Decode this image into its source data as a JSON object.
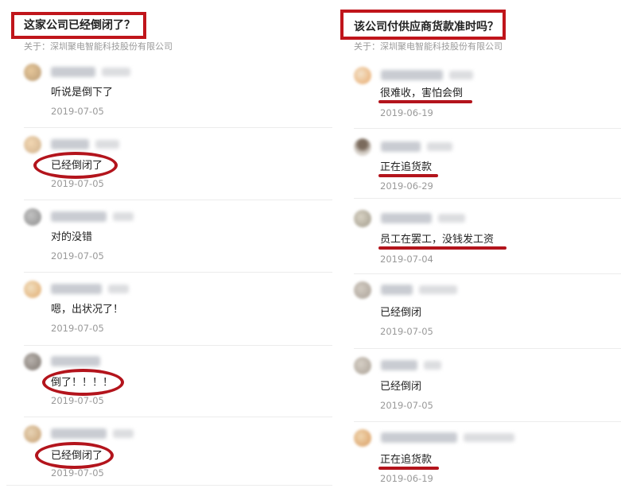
{
  "left": {
    "question": "这家公司已经倒闭了？",
    "about": "关于：深圳聚电智能科技股份有限公司",
    "answers": [
      {
        "text": "听说是倒下了",
        "date": "2019-07-05"
      },
      {
        "text": "已经倒闭了",
        "date": "2019-07-05"
      },
      {
        "text": "对的没错",
        "date": "2019-07-05"
      },
      {
        "text": "嗯，出状况了！",
        "date": "2019-07-05"
      },
      {
        "text": "倒了！！！！",
        "date": "2019-07-05"
      },
      {
        "text": "已经倒闭了",
        "date": "2019-07-05"
      }
    ]
  },
  "right": {
    "question": "该公司付供应商货款准时吗？",
    "about": "关于：深圳聚电智能科技股份有限公司",
    "answers": [
      {
        "text": "很难收，害怕会倒",
        "date": "2019-06-19"
      },
      {
        "text": "正在追货款",
        "date": "2019-06-29"
      },
      {
        "text": "员工在罢工，没钱发工资",
        "date": "2019-07-04"
      },
      {
        "text": "已经倒闭",
        "date": "2019-07-05"
      },
      {
        "text": "已经倒闭",
        "date": "2019-07-05"
      },
      {
        "text": "正在追货款",
        "date": "2019-06-19"
      }
    ]
  },
  "colors": {
    "highlight_red": "#b3141c",
    "frame_red": "#c0151b",
    "date_gray": "#999999"
  }
}
